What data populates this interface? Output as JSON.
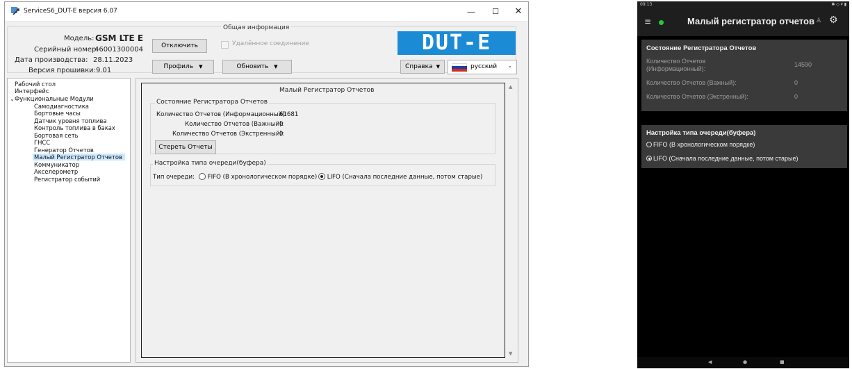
{
  "window": {
    "title": "ServiceS6_DUT-E версия 6.07",
    "min": "—",
    "max": "☐",
    "close": "✕"
  },
  "info": {
    "legend": "Общая информация",
    "model_label": "Модель:",
    "model_value": "GSM LTE E",
    "serial_label": "Серийный номер:",
    "serial_value": "46001300004",
    "date_label": "Дата производства:",
    "date_value": "28.11.2023",
    "fw_label": "Версия прошивки:",
    "fw_value": "9.01",
    "disconnect": "Отключить",
    "remote": "Удалённое соединение",
    "profile": "Профиль",
    "refresh": "Обновить",
    "help": "Справка",
    "language": "русский",
    "logo": "DUT-E"
  },
  "tree": {
    "items": [
      "Рабочий стол",
      "Интерфейс",
      "Функциональные Модули",
      "Самодиагностика",
      "Бортовые часы",
      "Датчик уровня топлива",
      "Контроль топлива в баках",
      "Бортовая сеть",
      "ГНСС",
      "Генератор Отчетов",
      "Малый Регистратор Отчетов",
      "Коммуникатор",
      "Акселерометр",
      "Регистратор событий"
    ]
  },
  "panel": {
    "title": "Малый Регистратор Отчетов",
    "state_group": "Состояние Регистратора Отчетов",
    "info_label": "Количество Отчетов (Информационный):",
    "info_value": "61681",
    "important_label": "Количество Отчетов (Важный):",
    "important_value": "0",
    "emergency_label": "Количество Отчетов (Экстренный):",
    "emergency_value": "0",
    "erase": "Стереть Отчеты",
    "queue_group": "Настройка типа очереди(буфера)",
    "queue_label": "Тип очереди:",
    "fifo": "FIFO (В хронологическом порядке)",
    "lifo": "LIFO (Сначала последние данные, потом старые)",
    "selected": "LIFO"
  },
  "phone": {
    "status_time": "09:13",
    "title": "Малый регистратор отчетов",
    "state_head": "Состояние Регистратора Отчетов",
    "info_label": "Количество Отчетов (Информационный):",
    "info_value": "14590",
    "important_label": "Количество Отчетов (Важный):",
    "important_value": "0",
    "emergency_label": "Количество Отчетов (Экстренный):",
    "emergency_value": "0",
    "queue_head": "Настройка типа очереди(буфера)",
    "fifo": "FIFO (В хронологическом порядке)",
    "lifo": "LIFO (Сначала последние данные, потом старые)",
    "selected": "LIFO"
  },
  "colors": {
    "logo_bg": "#1b8bd6",
    "tree_selection": "#cce8ff",
    "phone_card": "#3a3a3a",
    "connection_dot": "#27c93f"
  }
}
